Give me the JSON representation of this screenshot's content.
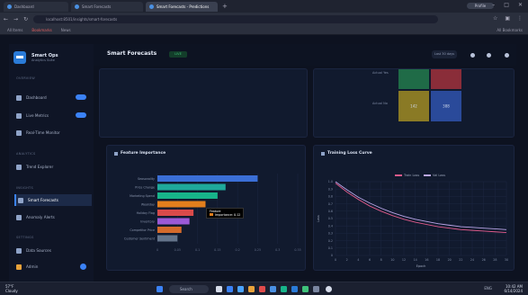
{
  "browser": {
    "tabs": [
      {
        "label": "Dashboard"
      },
      {
        "label": "Smart Forecasts"
      },
      {
        "label": "Smart Forecasts - Predictions"
      }
    ],
    "profile_label": "Profile",
    "url": "localhost:8501/insights/smart-forecasts",
    "bookmarks": [
      "All Items",
      "Bookmarks",
      "News"
    ],
    "bookmarks_right": "All Bookmarks"
  },
  "sidebar": {
    "brand_name": "Smart Ops",
    "brand_sub": "Analytics Suite",
    "sections": [
      "OVERVIEW",
      "ANALYTICS",
      "INSIGHTS",
      "SETTINGS"
    ],
    "items": [
      {
        "label": "Dashboard"
      },
      {
        "label": "Live Metrics"
      },
      {
        "label": "Real-Time Monitor"
      },
      {
        "label": "Trend Explorer"
      },
      {
        "label": "Smart Forecasts"
      },
      {
        "label": "Anomaly Alerts"
      },
      {
        "label": "Data Sources"
      },
      {
        "label": "Admin"
      }
    ]
  },
  "topbar": {
    "title": "Smart Forecasts",
    "badge": "LIVE",
    "pill": "Last 30 days"
  },
  "matrix": {
    "row_labels": [
      "Actual Yes",
      "Actual No"
    ],
    "cells": [
      "",
      "",
      "142",
      "388"
    ],
    "cell_colors": [
      "#1f6b47",
      "#8a2d39",
      "#8a7a25",
      "#2a4a9a"
    ]
  },
  "feature_panel": {
    "title": "Feature Importance",
    "tooltip_title": "Feature",
    "tooltip_value": "Importance: 0.12"
  },
  "training_panel": {
    "title": "Training Loss Curve",
    "legend": [
      "Train Loss",
      "Val Loss"
    ],
    "y_label": "Loss",
    "x_label": "Epoch"
  },
  "chart_data": [
    {
      "type": "bar",
      "orientation": "horizontal",
      "title": "Feature Importance",
      "categories": [
        "Seasonality",
        "Price Change",
        "Marketing Spend",
        "Weekday",
        "Holiday Flag",
        "Inventory",
        "Competitor Price",
        "Customer Sentiment"
      ],
      "values": [
        0.25,
        0.17,
        0.15,
        0.12,
        0.09,
        0.08,
        0.06,
        0.05
      ],
      "colors": [
        "#3b6fd6",
        "#1fa99b",
        "#17b48a",
        "#e37f1d",
        "#d94a4a",
        "#9b59d6",
        "#d46a2b",
        "#64748b"
      ],
      "xlim": [
        0,
        0.35
      ],
      "xticks": [
        "0",
        "0.05",
        "0.1",
        "0.15",
        "0.2",
        "0.25",
        "0.3",
        "0.35"
      ]
    },
    {
      "type": "line",
      "title": "Training Loss Curve",
      "x": [
        0,
        2,
        4,
        6,
        8,
        10,
        12,
        14,
        16,
        18,
        20,
        22,
        24,
        26,
        28,
        30
      ],
      "series": [
        {
          "name": "Train Loss",
          "color": "#e05a8a",
          "values": [
            0.98,
            0.86,
            0.76,
            0.67,
            0.6,
            0.54,
            0.49,
            0.45,
            0.42,
            0.39,
            0.37,
            0.35,
            0.34,
            0.33,
            0.32,
            0.31
          ]
        },
        {
          "name": "Val Loss",
          "color": "#b9a6e8",
          "values": [
            1.0,
            0.89,
            0.79,
            0.71,
            0.64,
            0.58,
            0.53,
            0.49,
            0.46,
            0.43,
            0.41,
            0.39,
            0.38,
            0.37,
            0.36,
            0.35
          ]
        }
      ],
      "ylim": [
        0,
        1.0
      ],
      "yticks": [
        "1.0",
        "0.9",
        "0.8",
        "0.7",
        "0.6",
        "0.5",
        "0.4",
        "0.3",
        "0.2",
        "0.1",
        "0"
      ],
      "xticks": [
        "0",
        "2",
        "4",
        "6",
        "8",
        "10",
        "12",
        "14",
        "16",
        "18",
        "20",
        "22",
        "24",
        "26",
        "28",
        "30"
      ],
      "grid": true,
      "legend_position": "top"
    }
  ],
  "taskbar": {
    "weather_temp": "57°F",
    "weather_desc": "Cloudy",
    "search": "Search",
    "time": "10:42 AM",
    "date": "6/14/2024",
    "sys": "ENG"
  }
}
